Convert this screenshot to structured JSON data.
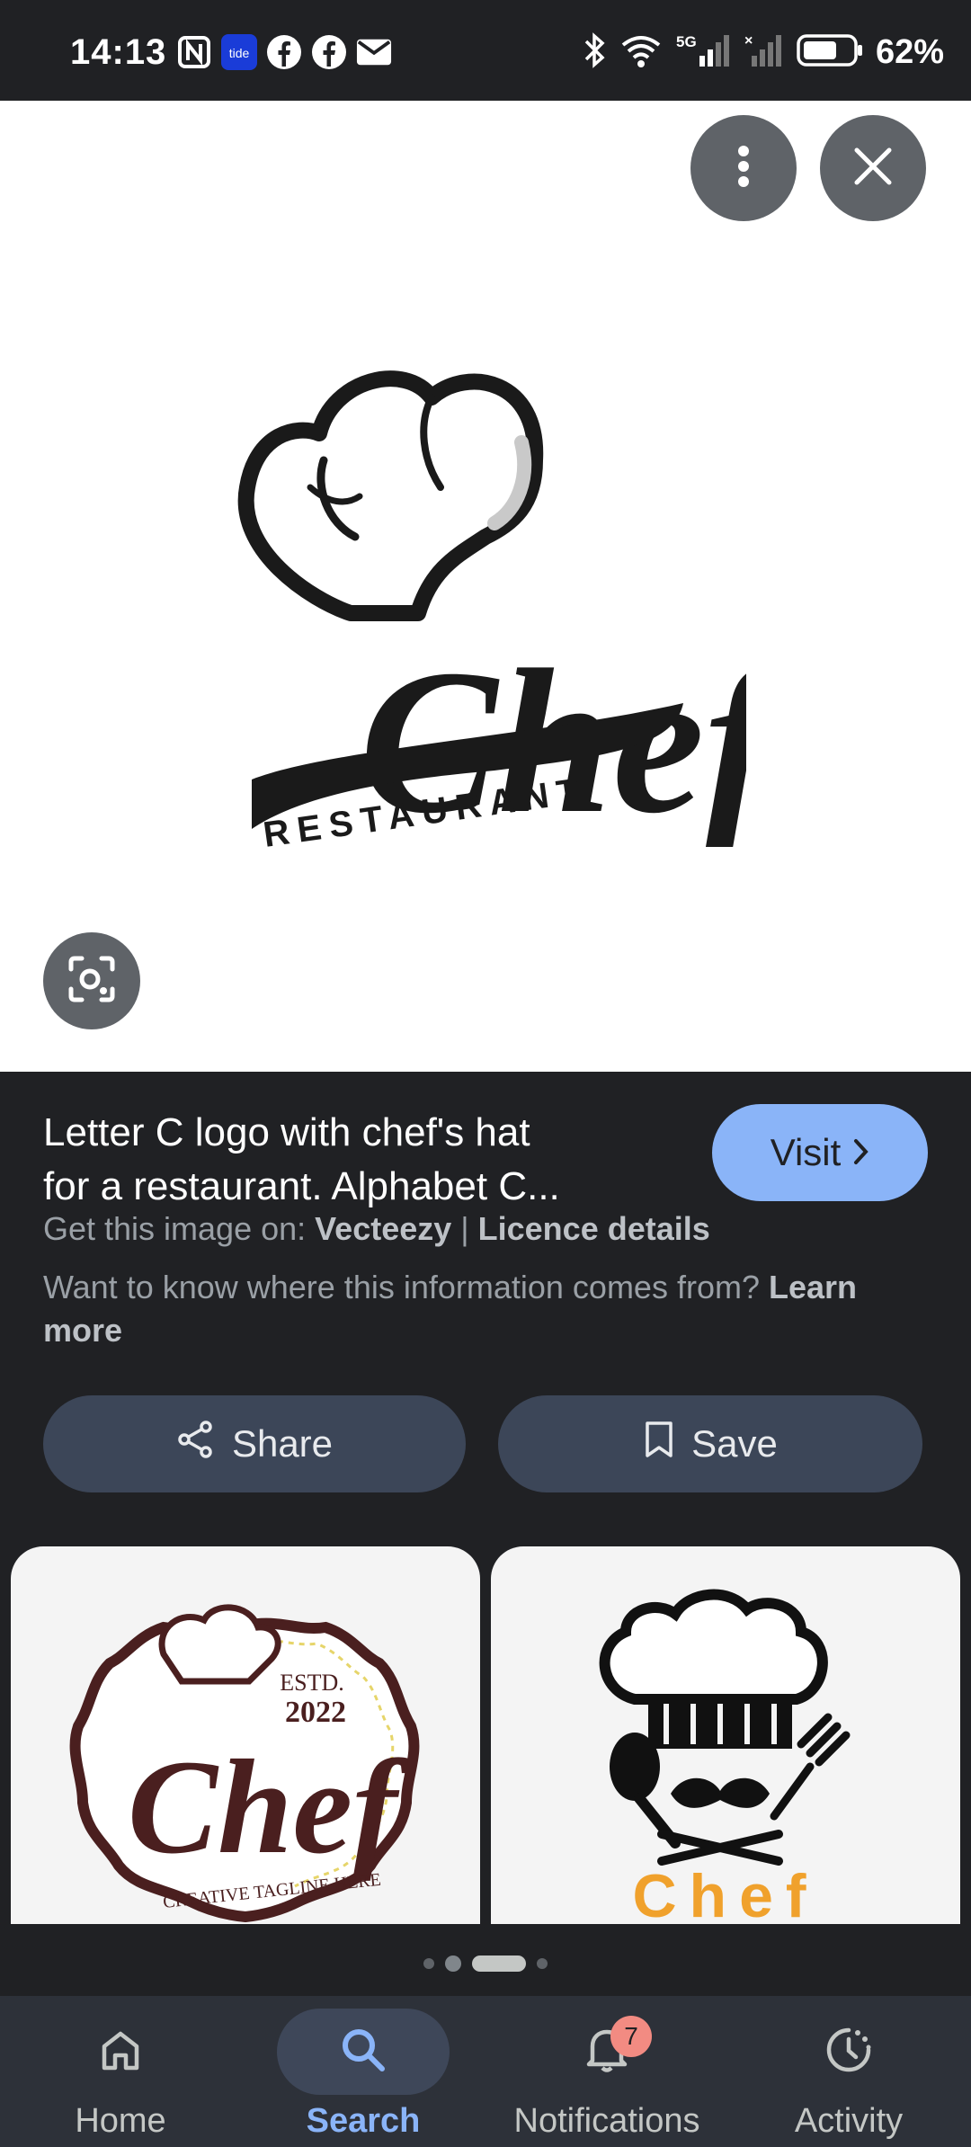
{
  "status_bar": {
    "time": "14:13",
    "battery": "62%",
    "network": "5G",
    "left_icons": [
      "nfc-icon",
      "tide-icon",
      "facebook-icon",
      "facebook-icon",
      "mail-icon"
    ],
    "tide_label": "tide"
  },
  "viewer": {
    "logo": {
      "word": "Chef",
      "tagline": "RESTAURANT"
    }
  },
  "info": {
    "title_line1": "Letter C logo with chef's hat",
    "title_line2": "for a restaurant. Alphabet C...",
    "visit_label": "Visit",
    "source_prefix": "Get this image on: ",
    "source_name": "Vecteezy",
    "separator": " | ",
    "licence_label": "Licence details",
    "note_text": "Want to know where this information comes from? ",
    "learn_more": "Learn more",
    "share_label": "Share",
    "save_label": "Save"
  },
  "related": [
    {
      "word": "Chef",
      "estd": "ESTD.",
      "year": "2022",
      "tagline": "CREATIVE TAGLINE HERE"
    },
    {
      "word": "Chef"
    }
  ],
  "bottom_nav": {
    "items": [
      {
        "label": "Home",
        "icon": "home-icon"
      },
      {
        "label": "Search",
        "icon": "search-icon",
        "active": true
      },
      {
        "label": "Notifications",
        "icon": "bell-icon",
        "badge": "7"
      },
      {
        "label": "Activity",
        "icon": "activity-icon"
      }
    ]
  },
  "colors": {
    "accent": "#8ab4f8",
    "panel": "#202124",
    "button": "#3c4658",
    "badge": "#f28b82"
  }
}
